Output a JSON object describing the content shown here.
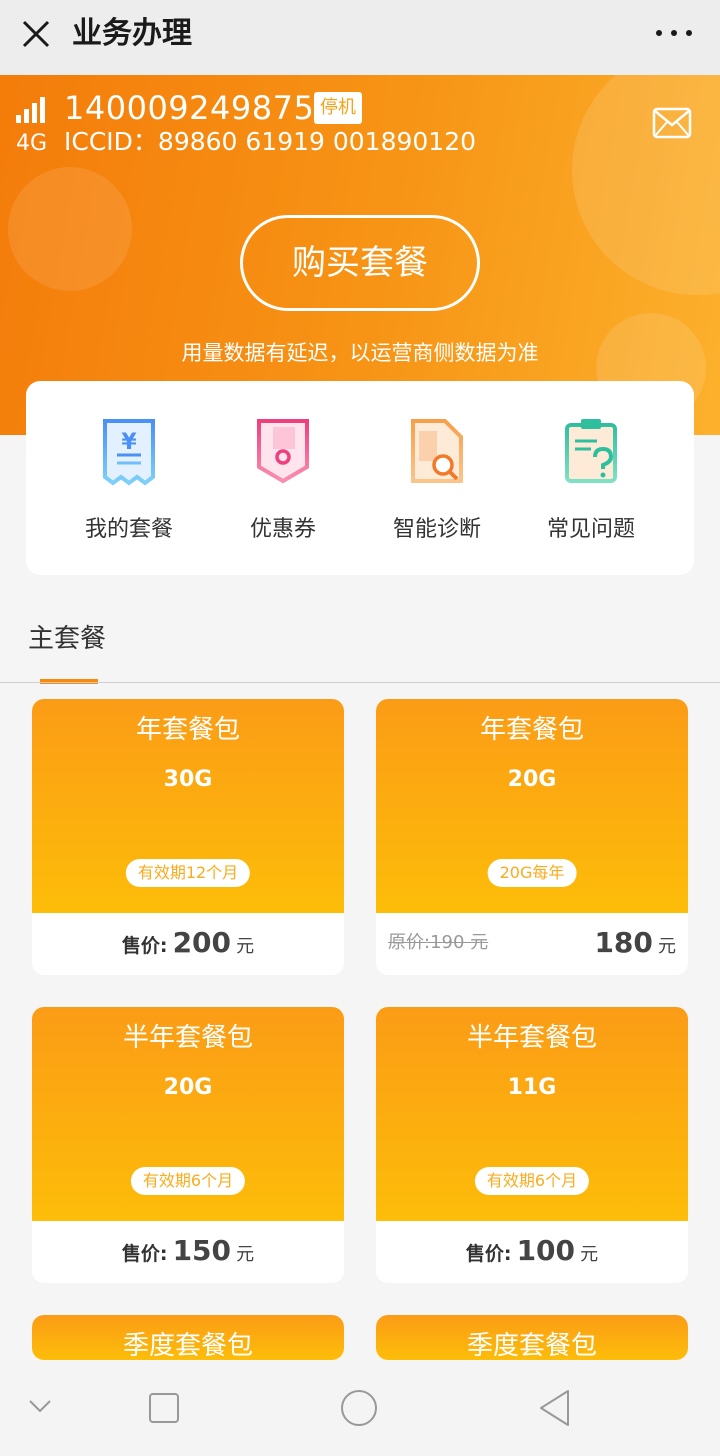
{
  "topbar": {
    "title": "业务办理",
    "close_icon": "close-icon",
    "more_icon": "more-icon"
  },
  "hero": {
    "network": "4G",
    "phone": "1400092498756",
    "status_badge": "停机",
    "iccid": "ICCID：89860 61919 001890120",
    "buy_button": "购买套餐",
    "notice": "用量数据有延迟，以运营商侧数据为准",
    "mail_icon": "mail-icon",
    "signal_icon": "signal-icon"
  },
  "menu": [
    {
      "label": "我的套餐",
      "icon": "receipt-yen-icon"
    },
    {
      "label": "优惠券",
      "icon": "coupon-icon"
    },
    {
      "label": "智能诊断",
      "icon": "document-search-icon"
    },
    {
      "label": "常见问题",
      "icon": "clipboard-question-icon"
    }
  ],
  "section": {
    "title": "主套餐"
  },
  "packages": [
    {
      "name": "年套餐包",
      "data": "30G",
      "tag": "有效期12个月",
      "price_label": "售价:",
      "price": "200",
      "unit": "元"
    },
    {
      "name": "年套餐包",
      "data": "20G",
      "tag": "20G每年",
      "original": "原价:190 元",
      "price": "180",
      "unit": "元"
    },
    {
      "name": "半年套餐包",
      "data": "20G",
      "tag": "有效期6个月",
      "price_label": "售价:",
      "price": "150",
      "unit": "元"
    },
    {
      "name": "半年套餐包",
      "data": "11G",
      "tag": "有效期6个月",
      "price_label": "售价:",
      "price": "100",
      "unit": "元"
    },
    {
      "name": "季度套餐包"
    },
    {
      "name": "季度套餐包"
    }
  ],
  "colors": {
    "accent": "#f7890e",
    "hero_start": "#f47c0a",
    "hero_end": "#fcb12c",
    "card_top": "#fb9c16",
    "card_bottom": "#fdbd09"
  }
}
